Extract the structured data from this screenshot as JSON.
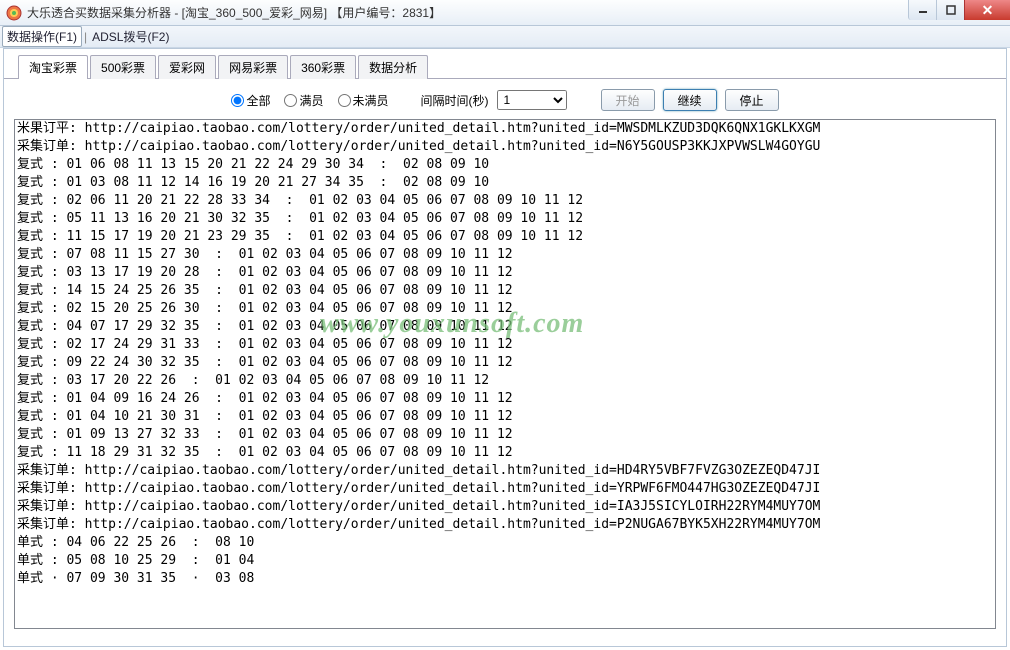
{
  "window": {
    "title": "大乐透合买数据采集分析器 - [淘宝_360_500_爱彩_网易]      【用户编号：2831】"
  },
  "menu": {
    "item1": "数据操作(F1)",
    "sep": "|",
    "item2": "ADSL拨号(F2)"
  },
  "tabs": [
    "淘宝彩票",
    "500彩票",
    "爱彩网",
    "网易彩票",
    "360彩票",
    "数据分析"
  ],
  "toolbar": {
    "radios": {
      "all": "全部",
      "full": "满员",
      "notfull": "未满员"
    },
    "interval_label": "间隔时间(秒)",
    "interval_value": "1",
    "start": "开始",
    "continue": "继续",
    "stop": "停止"
  },
  "watermark": "www.youxunsoft.com",
  "log_lines": [
    "米果订平: http://caipiao.taobao.com/lottery/order/united_detail.htm?united_id=MWSDMLKZUD3DQK6QNX1GKLKXGM",
    "采集订单: http://caipiao.taobao.com/lottery/order/united_detail.htm?united_id=N6Y5GOUSP3KKJXPVWSLW4GOYGU",
    "复式 : 01 06 08 11 13 15 20 21 22 24 29 30 34  :  02 08 09 10",
    "复式 : 01 03 08 11 12 14 16 19 20 21 27 34 35  :  02 08 09 10",
    "复式 : 02 06 11 20 21 22 28 33 34  :  01 02 03 04 05 06 07 08 09 10 11 12",
    "复式 : 05 11 13 16 20 21 30 32 35  :  01 02 03 04 05 06 07 08 09 10 11 12",
    "复式 : 11 15 17 19 20 21 23 29 35  :  01 02 03 04 05 06 07 08 09 10 11 12",
    "复式 : 07 08 11 15 27 30  :  01 02 03 04 05 06 07 08 09 10 11 12",
    "复式 : 03 13 17 19 20 28  :  01 02 03 04 05 06 07 08 09 10 11 12",
    "复式 : 14 15 24 25 26 35  :  01 02 03 04 05 06 07 08 09 10 11 12",
    "复式 : 02 15 20 25 26 30  :  01 02 03 04 05 06 07 08 09 10 11 12",
    "复式 : 04 07 17 29 32 35  :  01 02 03 04 05 06 07 08 09 10 11 12",
    "复式 : 02 17 24 29 31 33  :  01 02 03 04 05 06 07 08 09 10 11 12",
    "复式 : 09 22 24 30 32 35  :  01 02 03 04 05 06 07 08 09 10 11 12",
    "复式 : 03 17 20 22 26  :  01 02 03 04 05 06 07 08 09 10 11 12",
    "复式 : 01 04 09 16 24 26  :  01 02 03 04 05 06 07 08 09 10 11 12",
    "复式 : 01 04 10 21 30 31  :  01 02 03 04 05 06 07 08 09 10 11 12",
    "复式 : 01 09 13 27 32 33  :  01 02 03 04 05 06 07 08 09 10 11 12",
    "复式 : 11 18 29 31 32 35  :  01 02 03 04 05 06 07 08 09 10 11 12",
    "采集订单: http://caipiao.taobao.com/lottery/order/united_detail.htm?united_id=HD4RY5VBF7FVZG3OZEZEQD47JI",
    "采集订单: http://caipiao.taobao.com/lottery/order/united_detail.htm?united_id=YRPWF6FMO447HG3OZEZEQD47JI",
    "采集订单: http://caipiao.taobao.com/lottery/order/united_detail.htm?united_id=IA3J5SICYLOIRH22RYM4MUY7OM",
    "采集订单: http://caipiao.taobao.com/lottery/order/united_detail.htm?united_id=P2NUGA67BYK5XH22RYM4MUY7OM",
    "单式 : 04 06 22 25 26  :  08 10",
    "单式 : 05 08 10 25 29  :  01 04",
    "单式 · 07 09 30 31 35  ·  03 08"
  ]
}
